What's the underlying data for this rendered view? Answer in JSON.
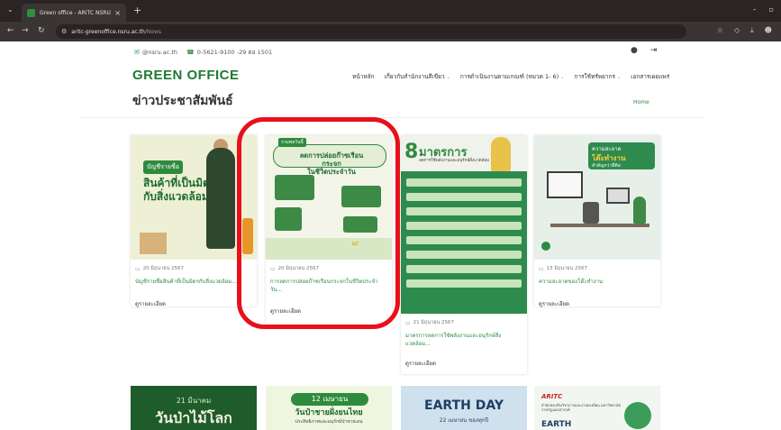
{
  "browser": {
    "tab_title": "Green office - ARITC NSRU",
    "tab_close": "×",
    "new_tab": "+",
    "url_host": "aritc-greenoffice.nsru.ac.th",
    "url_path": "/News"
  },
  "topbar": {
    "email": "@nsru.ac.th",
    "phone": "0-5621-9100 -29 ต่อ 1501"
  },
  "site": {
    "logo": "GREEN OFFICE",
    "nav": [
      {
        "label": "หน้าหลัก",
        "dropdown": false
      },
      {
        "label": "เกี่ยวกับสำนักงานสีเขียว",
        "dropdown": true
      },
      {
        "label": "การดำเนินงานตามเกณฑ์ (หมวด 1- 6)",
        "dropdown": true
      },
      {
        "label": "การใช้ทรัพยากร",
        "dropdown": true
      },
      {
        "label": "เอกสารเผยแพร่",
        "dropdown": false
      }
    ]
  },
  "page": {
    "title": "ข่าวประชาสัมพันธ์",
    "breadcrumb": "Home"
  },
  "cards": [
    {
      "date": "20 มิถุนายน 2567",
      "title": "บัญชีรายชื่อสินค้าที่เป็นมิตรกับสิ่งแวดล้อม...",
      "more": "ดูรายละเอียด",
      "thumb": {
        "pill": "บัญชีรายชื่อ",
        "line1": "สินค้าที่เป็นมิตร",
        "line2": "กับสิ่งแวดล้อม"
      }
    },
    {
      "date": "20 มิถุนายน 2567",
      "title": "การลดการปล่อยก๊าซเรือนกระจกในชีวิตประจำวัน...",
      "more": "ดูรายละเอียด",
      "thumb": {
        "badge": "รวมพลวันนี้",
        "line1": "ลดการปล่อยก๊าซเรือนกระจก",
        "line2": "ในชีวิตประจำวัน",
        "tag": "LC"
      }
    },
    {
      "date": "21 มิถุนายน 2567",
      "title": "มาตรการลดการใช้พลังงานและอนุรักษ์สิ่งแวดล้อม...",
      "more": "ดูรายละเอียด",
      "thumb": {
        "num": "8",
        "word": "มาตรการ",
        "sub": "ลดการใช้พลังงานและอนุรักษ์สิ่งแวดล้อม"
      }
    },
    {
      "date": "13 มิถุนายน 2567",
      "title": "ความสะอาดของโต๊ะทำงาน",
      "more": "ดูรายละเอียด",
      "thumb": {
        "b1": "ความสะอาด",
        "b2": "โต๊ะทำงาน",
        "b3": "สำคัญกว่าที่คิด"
      }
    }
  ],
  "bottom_cards": [
    {
      "small": "21 มีนาคม",
      "large": "วันป่าไม้โลก"
    },
    {
      "pill": "12 เมษายน",
      "large": "วันป๋าชายฝั่งยนไทย",
      "small": "ประสิทธิภาพและอนุรักษ์ป่าชายเลน"
    },
    {
      "large": "EARTH DAY",
      "small": "22 เมษายน ของทุกปี"
    },
    {
      "logo": "ARITC",
      "small": "สำนักส่งเสริมวิชาการและงานทะเบียน มหาวิทยาลัยราชภัฏนครสวรรค์",
      "large": "EARTH"
    }
  ],
  "colors": {
    "brand_green": "#1f7a34",
    "link_green": "#2e8b3e",
    "highlight_red": "#e8101a"
  }
}
